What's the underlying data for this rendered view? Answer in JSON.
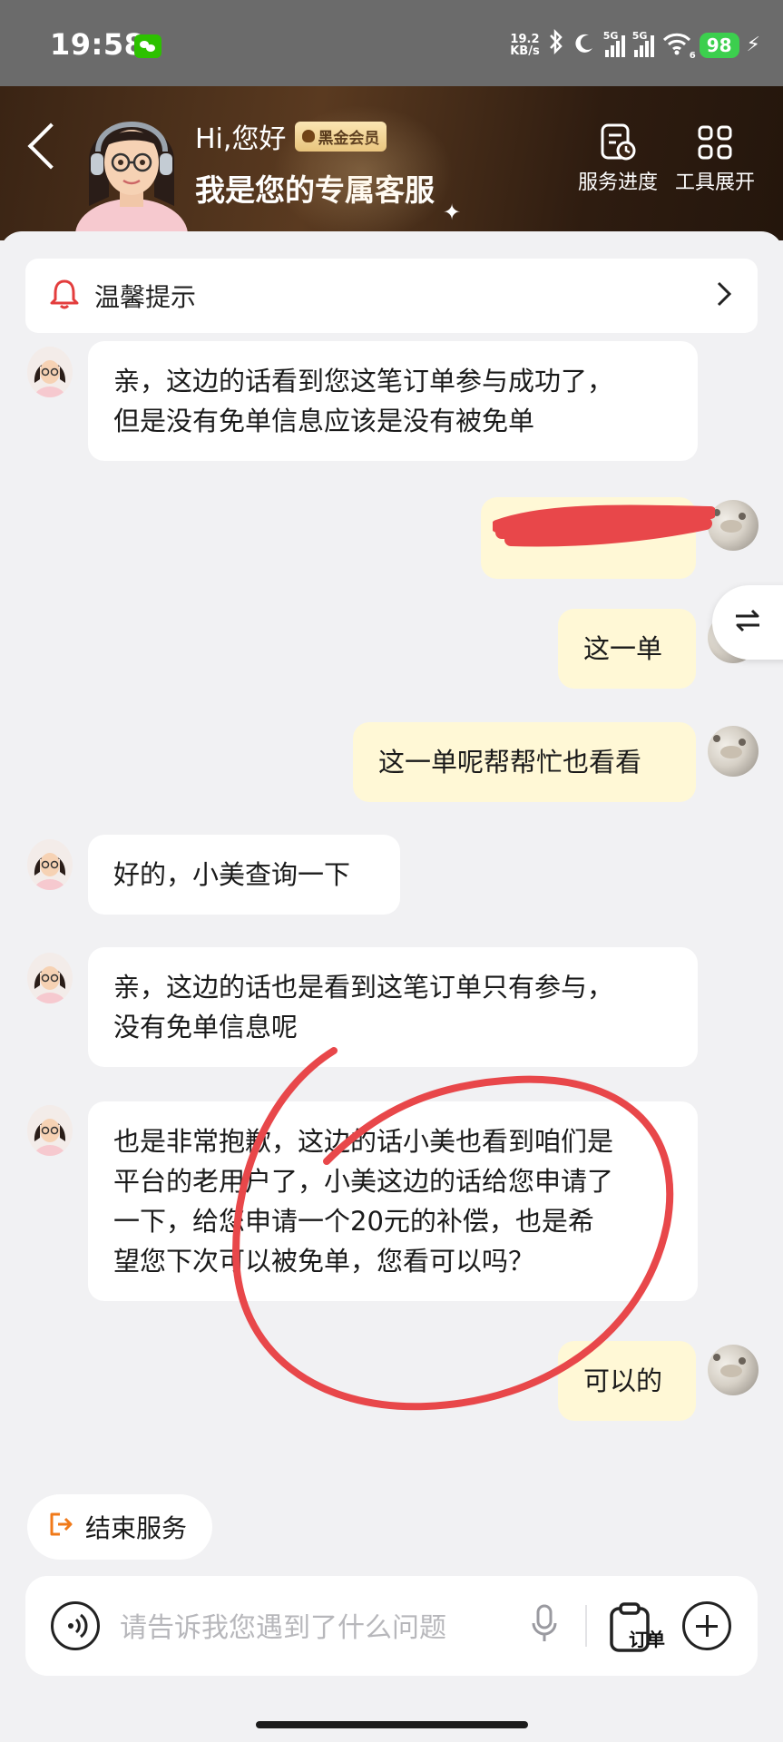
{
  "status_bar": {
    "time": "19:58",
    "net_speed_value": "19.2",
    "net_speed_unit": "KB/s",
    "signal1_label": "5G",
    "signal2_label": "5G",
    "wifi_label": "6",
    "battery": "98"
  },
  "header": {
    "greeting": "Hi,您好",
    "vip_badge": "黑金会员",
    "title": "我是您的专属客服",
    "tools": [
      {
        "label": "服务进度",
        "icon": "service-progress-icon"
      },
      {
        "label": "工具展开",
        "icon": "grid-icon"
      }
    ],
    "bg_color": "#3a2414"
  },
  "tip_bar": {
    "label": "温馨提示",
    "icon": "bell-icon"
  },
  "messages": [
    {
      "from": "agent",
      "text": "亲，这边的话看到您这笔订单参与成功了，\n但是没有免单信息应该是没有被免单"
    },
    {
      "from": "user",
      "text": "",
      "redacted": true
    },
    {
      "from": "user",
      "text": "这一单"
    },
    {
      "from": "user",
      "text": "这一单呢帮帮忙也看看"
    },
    {
      "from": "agent",
      "text": "好的，小美查询一下"
    },
    {
      "from": "agent",
      "text": "亲，这边的话也是看到这笔订单只有参与，\n没有免单信息呢"
    },
    {
      "from": "agent",
      "text": "也是非常抱歉，这边的话小美也看到咱们是\n平台的老用户了，小美这边的话给您申请了\n一下，给您申请一个20元的补偿，也是希\n望您下次可以被免单，您看可以吗？"
    },
    {
      "from": "user",
      "text": "可以的"
    }
  ],
  "end_service": {
    "label": "结束服务"
  },
  "input": {
    "placeholder": "请告诉我您遇到了什么问题",
    "order_label": "订单"
  },
  "colors": {
    "user_bubble": "#fff8d6",
    "agent_bubble": "#ffffff",
    "accent_orange": "#f07a1a",
    "annotation_red": "#e8474a"
  }
}
